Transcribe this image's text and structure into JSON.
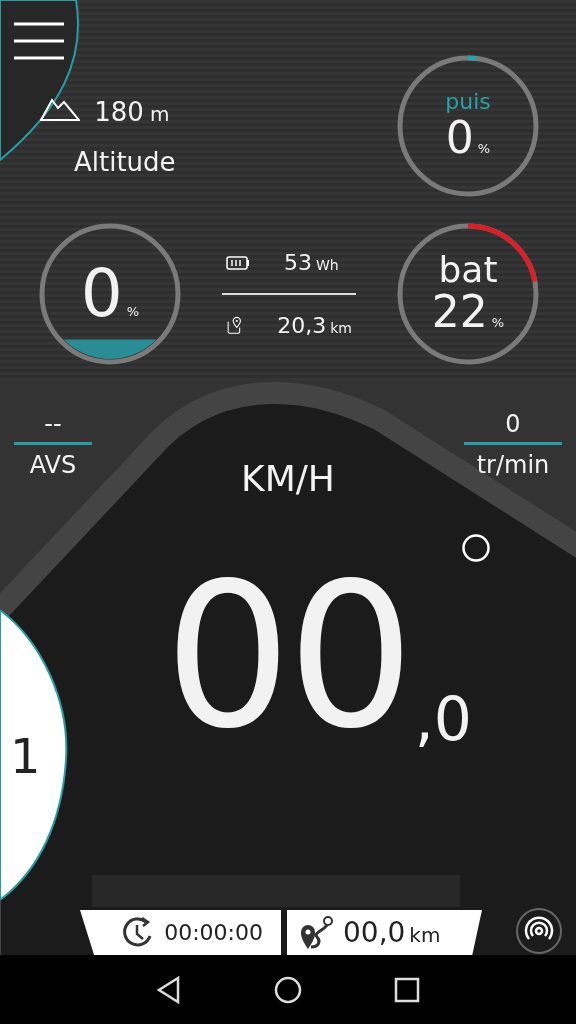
{
  "altitude": {
    "value": "180",
    "unit": "m",
    "label": "Altitude"
  },
  "power_gauge": {
    "label": "puis",
    "value": "0",
    "unit": "%"
  },
  "assist_gauge": {
    "value": "0",
    "unit": "%"
  },
  "energy": {
    "value": "53",
    "unit": "Wh"
  },
  "range": {
    "value": "20,3",
    "unit": "km"
  },
  "battery_gauge": {
    "label": "bat",
    "value": "22",
    "unit": "%"
  },
  "avs": {
    "value": "--",
    "label": "AVS"
  },
  "cadence": {
    "value": "0",
    "label": "tr/min"
  },
  "speed": {
    "unit": "KM/H",
    "integer": "00",
    "decimal": ",0"
  },
  "assist_level": {
    "value": "1"
  },
  "trip": {
    "time": "00:00:00",
    "distance": "00,0",
    "distance_unit": "km"
  }
}
